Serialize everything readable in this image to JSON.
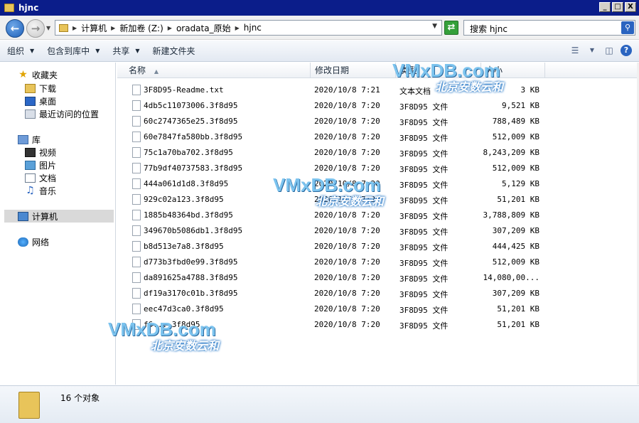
{
  "window": {
    "title": "hjnc",
    "minimize": "_",
    "maximize": "□",
    "close": "X"
  },
  "address": {
    "crumbs": [
      "计算机",
      "新加卷 (Z:)",
      "oradata_原始",
      "hjnc"
    ],
    "search_text": "搜索 hjnc"
  },
  "toolbar": {
    "organize": "组织",
    "include_library": "包含到库中",
    "share": "共享",
    "new_folder": "新建文件夹"
  },
  "nav": {
    "favorites": "收藏夹",
    "downloads": "下载",
    "desktop": "桌面",
    "recent": "最近访问的位置",
    "libraries": "库",
    "videos": "视频",
    "pictures": "图片",
    "documents": "文档",
    "music": "音乐",
    "computer": "计算机",
    "network": "网络"
  },
  "columns": {
    "name": "名称",
    "date": "修改日期",
    "type": "类型",
    "size": "大小"
  },
  "files": [
    {
      "name": "3F8D95-Readme.txt",
      "date": "2020/10/8 7:21",
      "type": "文本文档",
      "size": "3 KB"
    },
    {
      "name": "4db5c11073006.3f8d95",
      "date": "2020/10/8 7:20",
      "type": "3F8D95 文件",
      "size": "9,521 KB"
    },
    {
      "name": "60c2747365e25.3f8d95",
      "date": "2020/10/8 7:20",
      "type": "3F8D95 文件",
      "size": "788,489 KB"
    },
    {
      "name": "60e7847fa580bb.3f8d95",
      "date": "2020/10/8 7:20",
      "type": "3F8D95 文件",
      "size": "512,009 KB"
    },
    {
      "name": "75c1a70ba702.3f8d95",
      "date": "2020/10/8 7:20",
      "type": "3F8D95 文件",
      "size": "8,243,209 KB"
    },
    {
      "name": "77b9df40737583.3f8d95",
      "date": "2020/10/8 7:20",
      "type": "3F8D95 文件",
      "size": "512,009 KB"
    },
    {
      "name": "444a061d1d8.3f8d95",
      "date": "2020/10/8 7:20",
      "type": "3F8D95 文件",
      "size": "5,129 KB"
    },
    {
      "name": "929c02a123.3f8d95",
      "date": "2020/10/8 7:20",
      "type": "3F8D95 文件",
      "size": "51,201 KB"
    },
    {
      "name": "1885b48364bd.3f8d95",
      "date": "2020/10/8 7:20",
      "type": "3F8D95 文件",
      "size": "3,788,809 KB"
    },
    {
      "name": "349670b5086db1.3f8d95",
      "date": "2020/10/8 7:20",
      "type": "3F8D95 文件",
      "size": "307,209 KB"
    },
    {
      "name": "b8d513e7a8.3f8d95",
      "date": "2020/10/8 7:20",
      "type": "3F8D95 文件",
      "size": "444,425 KB"
    },
    {
      "name": "d773b3fbd0e99.3f8d95",
      "date": "2020/10/8 7:20",
      "type": "3F8D95 文件",
      "size": "512,009 KB"
    },
    {
      "name": "da891625a4788.3f8d95",
      "date": "2020/10/8 7:20",
      "type": "3F8D95 文件",
      "size": "14,080,00..."
    },
    {
      "name": "df19a3170c01b.3f8d95",
      "date": "2020/10/8 7:20",
      "type": "3F8D95 文件",
      "size": "307,209 KB"
    },
    {
      "name": "eec47d3ca0.3f8d95",
      "date": "2020/10/8 7:20",
      "type": "3F8D95 文件",
      "size": "51,201 KB"
    },
    {
      "name": "f6... 3f8d95",
      "date": "2020/10/8 7:20",
      "type": "3F8D95 文件",
      "size": "51,201 KB"
    }
  ],
  "status": {
    "count_text": "16 个对象"
  },
  "watermark": {
    "brand": "VMxDB.com",
    "slogan": "北京安数云和"
  },
  "colors": {
    "titlebar": "#0b1d8a",
    "watermark": "#7cc3ee"
  }
}
